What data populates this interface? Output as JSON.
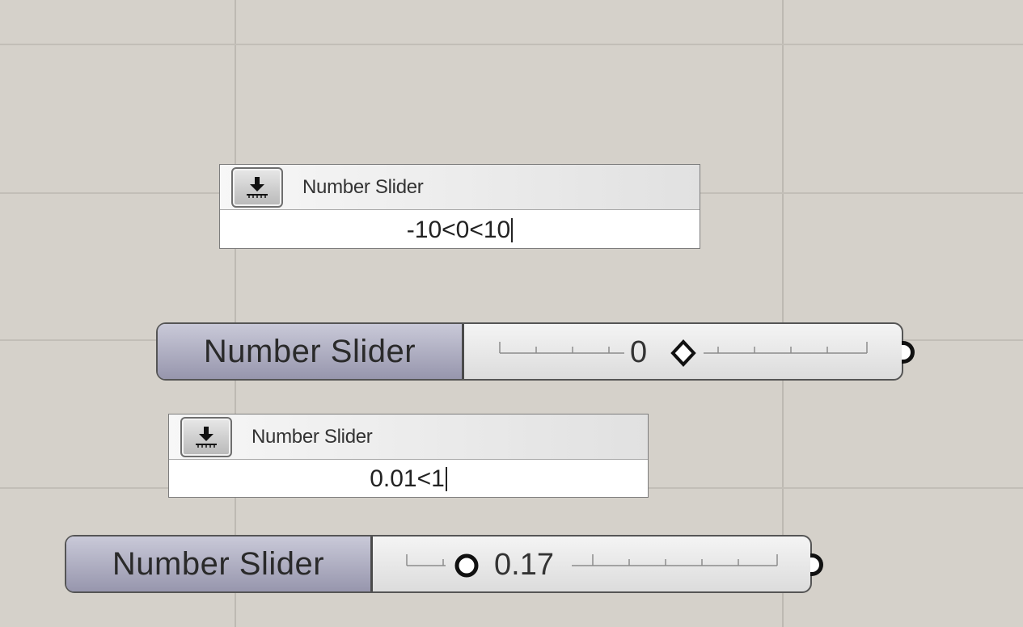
{
  "canvas": {
    "background": "#d5d1ca",
    "grid_color": "#bdb9b2"
  },
  "popups": [
    {
      "title": "Number Slider",
      "entry_text": "-10<0<10",
      "icon": "slider-download-icon"
    },
    {
      "title": "Number Slider",
      "entry_text": "0.01<1",
      "icon": "slider-download-icon"
    }
  ],
  "sliders": [
    {
      "label": "Number Slider",
      "value_text": "0",
      "value": 0,
      "min": -10,
      "max": 10,
      "handle": "diamond-handle-icon",
      "output": "output-grip-icon"
    },
    {
      "label": "Number Slider",
      "value_text": "0.17",
      "value": 0.17,
      "min": 0.01,
      "max": 1,
      "handle": "circle-handle-icon",
      "output": "output-grip-icon"
    }
  ]
}
